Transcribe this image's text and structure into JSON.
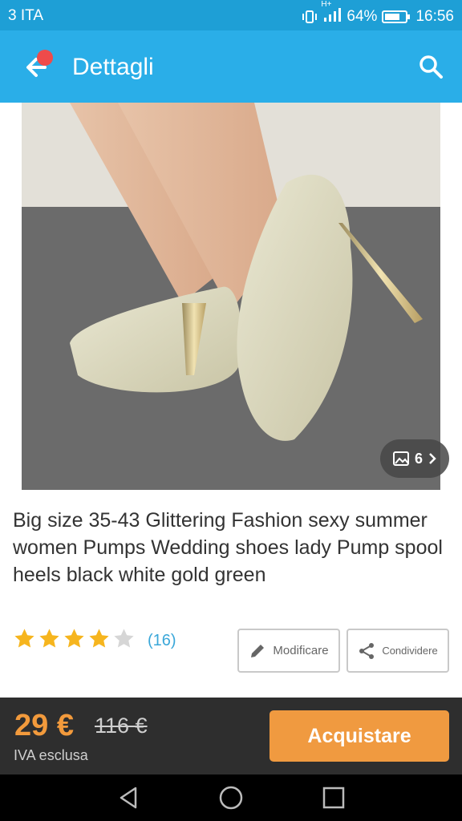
{
  "status_bar": {
    "carrier": "3 ITA",
    "network": "H+",
    "battery": "64%",
    "time": "16:56"
  },
  "app_bar": {
    "title": "Dettagli"
  },
  "product": {
    "image_count": "6",
    "title": "Big size 35-43 Glittering Fashion sexy summer women Pumps Wedding shoes lady Pump spool heels black white gold green",
    "rating": 4,
    "rating_max": 5,
    "review_count": "(16)"
  },
  "actions": {
    "modify_label": "Modificare",
    "share_label": "Condividere"
  },
  "purchase": {
    "price": "29 €",
    "old_price": "116 €",
    "vat_note": "IVA esclusa",
    "buy_label": "Acquistare"
  },
  "colors": {
    "header": "#2aaee8",
    "status": "#1e9fd6",
    "accent": "#f09a40",
    "star": "#f6b51e",
    "link": "#3aa7d9"
  }
}
